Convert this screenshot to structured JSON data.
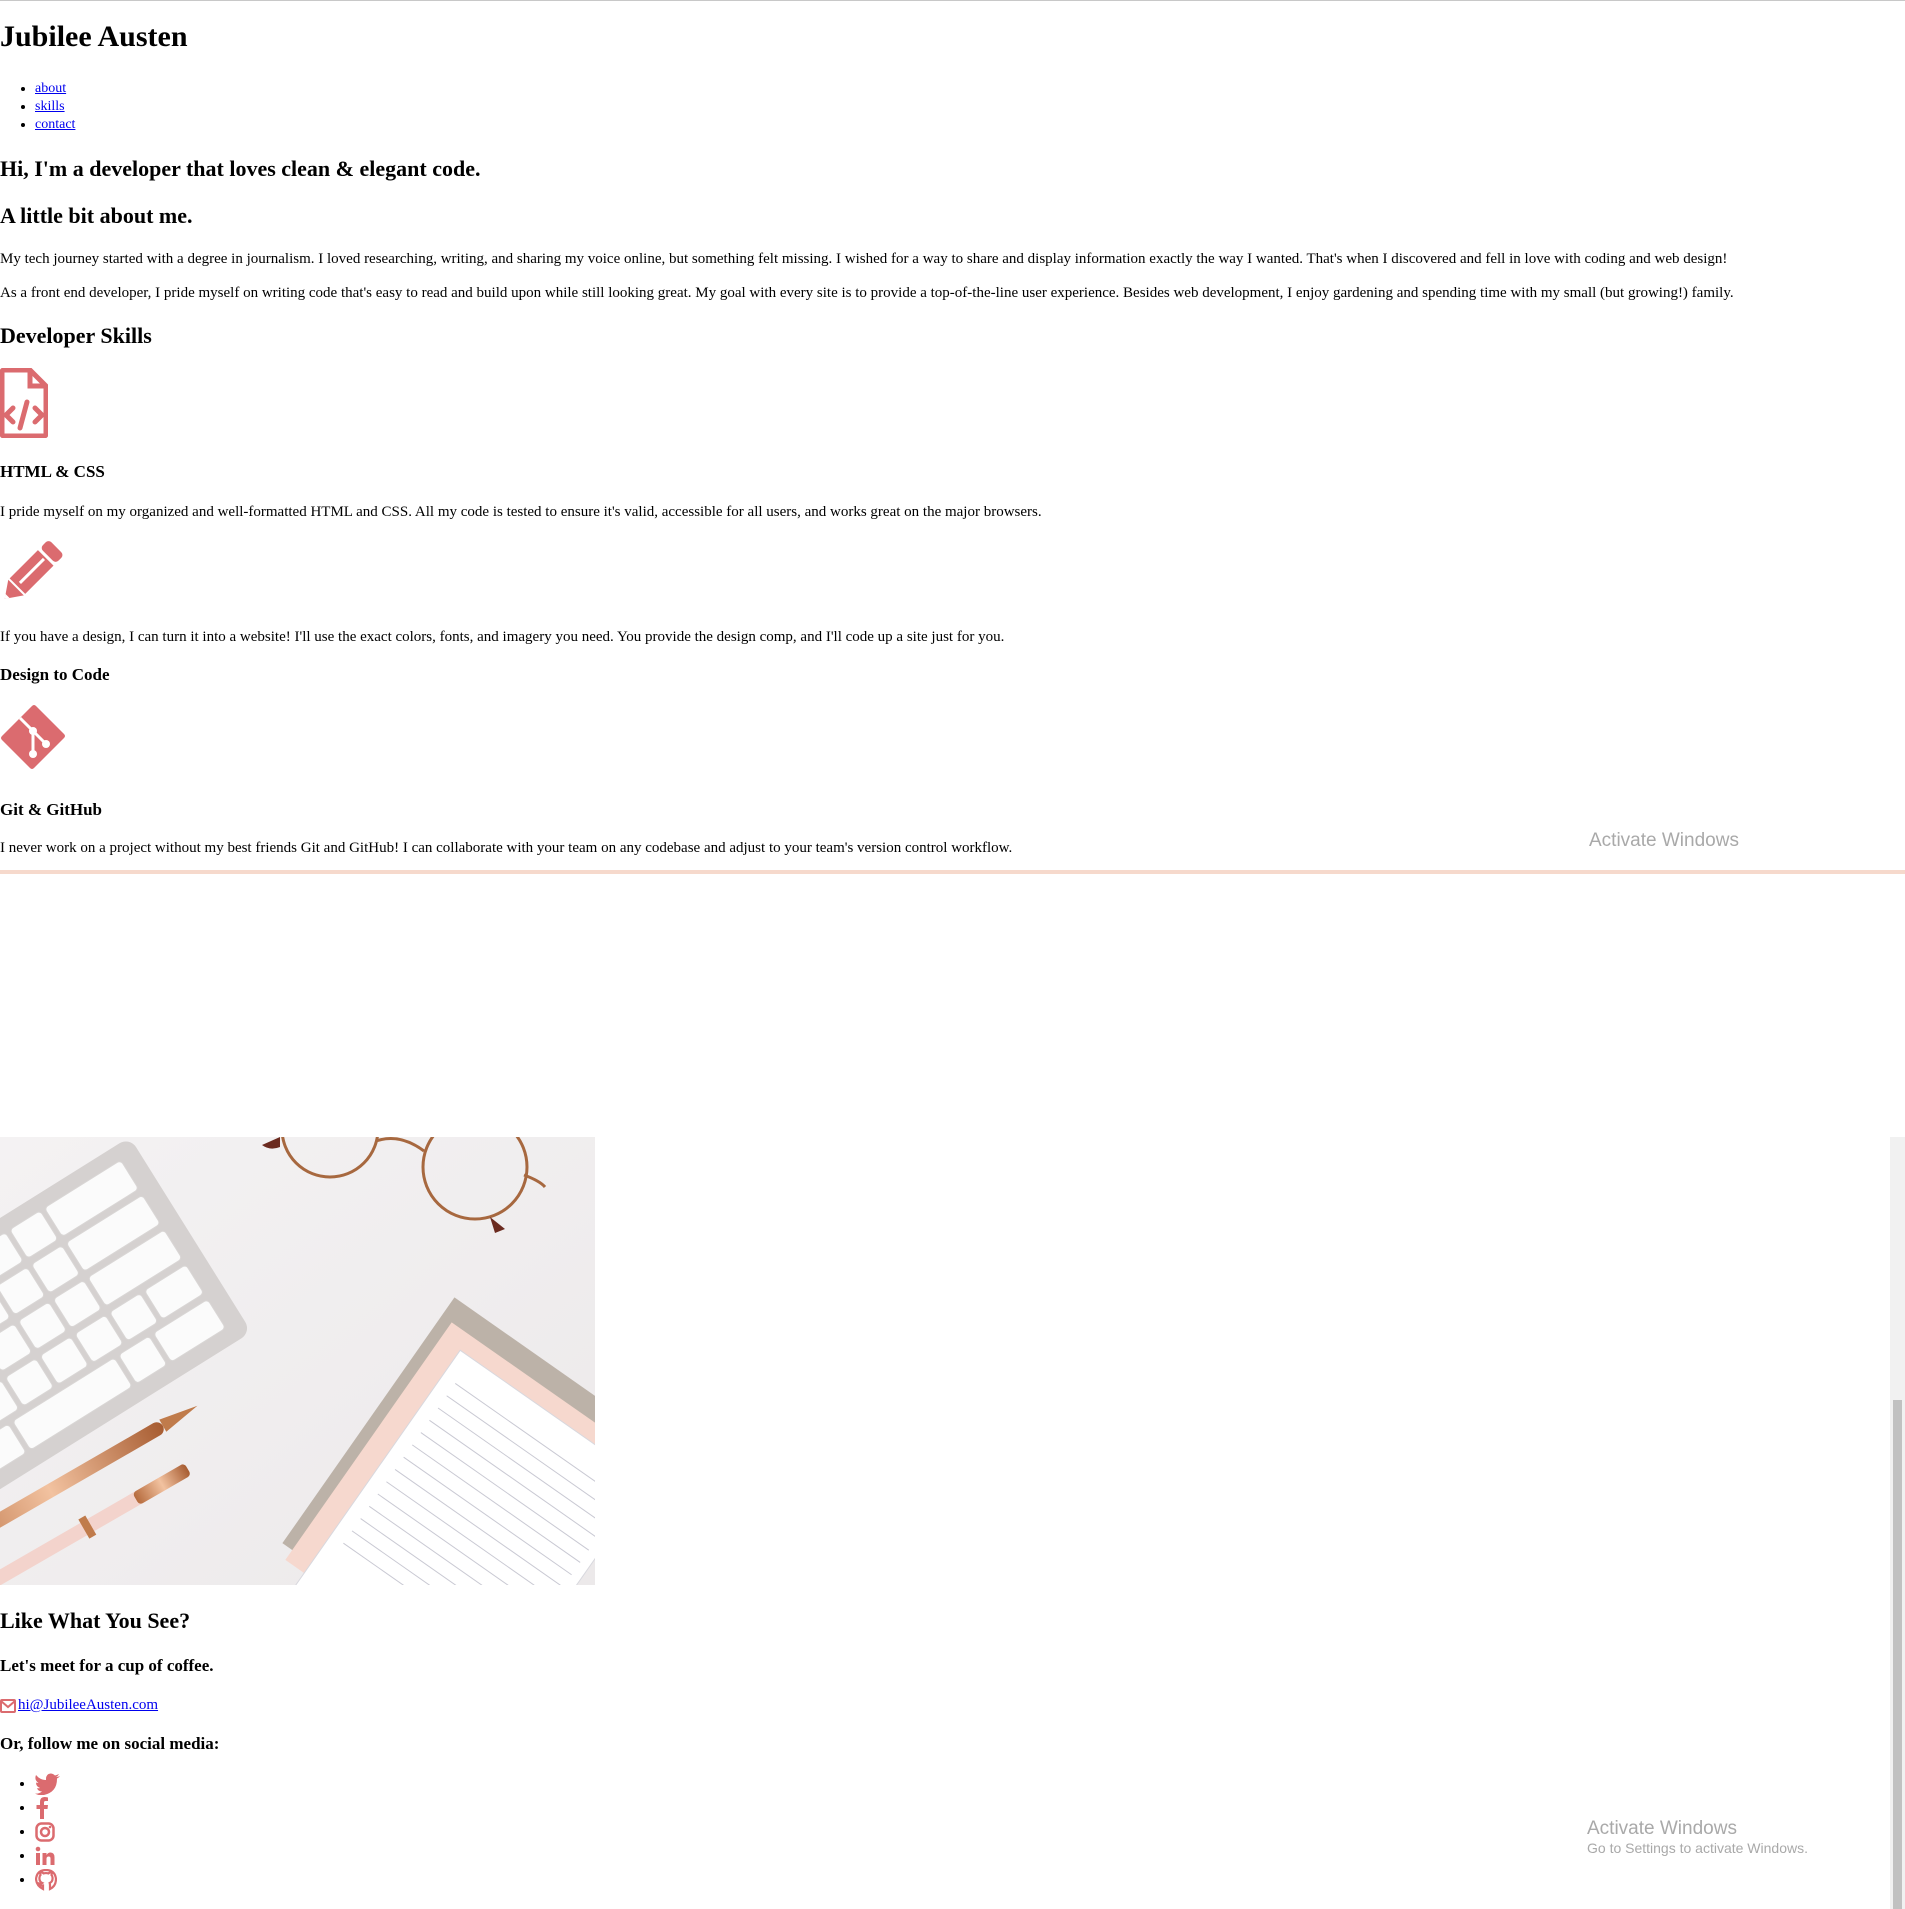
{
  "site": {
    "title": "Jubilee Austen"
  },
  "nav": {
    "items": [
      "about",
      "skills",
      "contact"
    ]
  },
  "hero": {
    "heading": "Hi, I'm a developer that loves clean & elegant code."
  },
  "about": {
    "heading": "A little bit about me.",
    "paragraph1": "My tech journey started with a degree in journalism. I loved researching, writing, and sharing my voice online, but something felt missing. I wished for a way to share and display information exactly the way I wanted. That's when I discovered and fell in love with coding and web design!",
    "paragraph2": "As a front end developer, I pride myself on writing code that's easy to read and build upon while still looking great. My goal with every site is to provide a top-of-the-line user experience. Besides web development, I enjoy gardening and spending time with my small (but growing!) family."
  },
  "skills": {
    "heading": "Developer Skills",
    "items": [
      {
        "icon": "file-code-icon",
        "title": "HTML & CSS",
        "text": "I pride myself on my organized and well-formatted HTML and CSS. All my code is tested to ensure it's valid, accessible for all users, and works great on the major browsers."
      },
      {
        "icon": "pencil-icon",
        "title": "Design to Code",
        "text": "If you have a design, I can turn it into a website! I'll use the exact colors, fonts, and imagery you need. You provide the design comp, and I'll code up a site just for you."
      },
      {
        "icon": "git-icon",
        "title": "Git & GitHub",
        "text": "I never work on a project without my best friends Git and GitHub! I can collaborate with your team on any codebase and adjust to your team's version control workflow."
      }
    ]
  },
  "contact": {
    "heading": "Like What You See?",
    "subheading": "Let's meet for a cup of coffee.",
    "email": "hi@JubileeAusten.com",
    "social_heading": "Or, follow me on social media:",
    "social": [
      "twitter-icon",
      "facebook-icon",
      "instagram-icon",
      "linkedin-icon",
      "github-icon"
    ]
  },
  "watermark": {
    "title": "Activate Windows",
    "subtitle": "Go to Settings to activate Windows."
  },
  "colors": {
    "accent": "#db6b6f",
    "link": "#0000ee",
    "peach_rule": "#f6d9cc"
  }
}
